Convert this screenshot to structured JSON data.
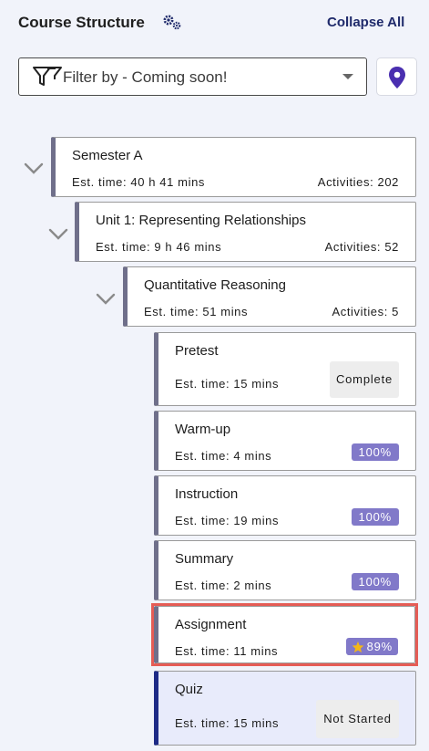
{
  "header": {
    "title": "Course Structure",
    "collapse_label": "Collapse All",
    "settings_icon": "gears-icon"
  },
  "filter": {
    "value": "Filter by - Coming soon!",
    "icon": "filter-icon",
    "location_icon": "map-pin-icon"
  },
  "colors": {
    "accent": "#1f2a6b",
    "badge": "#8179c9",
    "highlight": "#e55c55",
    "location": "#4a2fb0"
  },
  "tree": {
    "semester": {
      "name": "Semester A",
      "time": "Est. time: 40 h 41 mins",
      "activities": "Activities: 202"
    },
    "unit": {
      "name": "Unit 1: Representing Relationships",
      "time": "Est. time: 9 h 46 mins",
      "activities": "Activities: 52"
    },
    "lesson": {
      "name": "Quantitative Reasoning",
      "time": "Est. time: 51 mins",
      "activities": "Activities: 5"
    },
    "activities": [
      {
        "name": "Pretest",
        "time": "Est. time: 15 mins",
        "status": "Complete"
      },
      {
        "name": "Warm-up",
        "time": "Est. time: 4 mins",
        "status": "100%"
      },
      {
        "name": "Instruction",
        "time": "Est. time: 19 mins",
        "status": "100%"
      },
      {
        "name": "Summary",
        "time": "Est. time: 2 mins",
        "status": "100%"
      },
      {
        "name": "Assignment",
        "time": "Est. time: 11 mins",
        "status": "89%"
      },
      {
        "name": "Quiz",
        "time": "Est. time: 15 mins",
        "status": "Not Started"
      }
    ]
  }
}
